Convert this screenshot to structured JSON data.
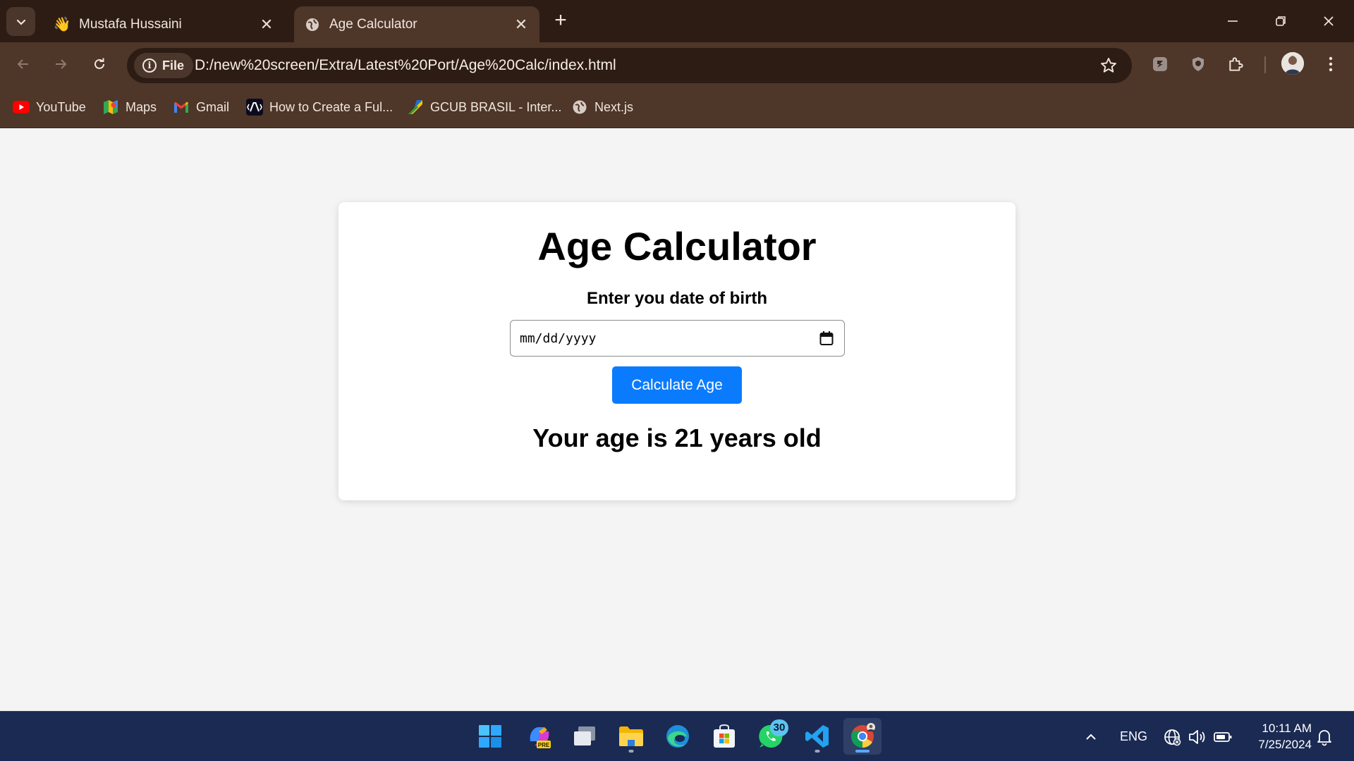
{
  "browser": {
    "tabs": [
      {
        "title": "Mustafa Hussaini",
        "favicon": "waving-hand-icon",
        "active": false
      },
      {
        "title": "Age Calculator",
        "favicon": "globe-icon",
        "active": true
      }
    ],
    "address_chip": "File",
    "url": "D:/new%20screen/Extra/Latest%20Port/Age%20Calc/index.html",
    "bookmarks": [
      {
        "label": "YouTube",
        "icon": "youtube-icon"
      },
      {
        "label": "Maps",
        "icon": "maps-icon"
      },
      {
        "label": "Gmail",
        "icon": "gmail-icon"
      },
      {
        "label": "How to Create a Ful...",
        "icon": "dev-icon"
      },
      {
        "label": "GCUB BRASIL - Inter...",
        "icon": "gcub-icon"
      },
      {
        "label": "Next.js",
        "icon": "globe-icon"
      }
    ],
    "colors": {
      "frame": "#2d1c14",
      "toolbar": "#4e3629"
    }
  },
  "page": {
    "title": "Age Calculator",
    "dob_label": "Enter you date of birth",
    "date_placeholder": "mm/dd/yyyy",
    "button_label": "Calculate Age",
    "result": "Your age is 21 years old",
    "colors": {
      "button": "#0b7bfe",
      "background": "#f4f4f4"
    }
  },
  "taskbar": {
    "apps": [
      "windows-start-icon",
      "copilot-icon",
      "task-view-icon",
      "file-explorer-icon",
      "edge-icon",
      "microsoft-store-icon",
      "whatsapp-icon",
      "vscode-icon",
      "chrome-icon"
    ],
    "whatsapp_badge": "30",
    "language": "ENG",
    "time": "10:11 AM",
    "date": "7/25/2024"
  }
}
